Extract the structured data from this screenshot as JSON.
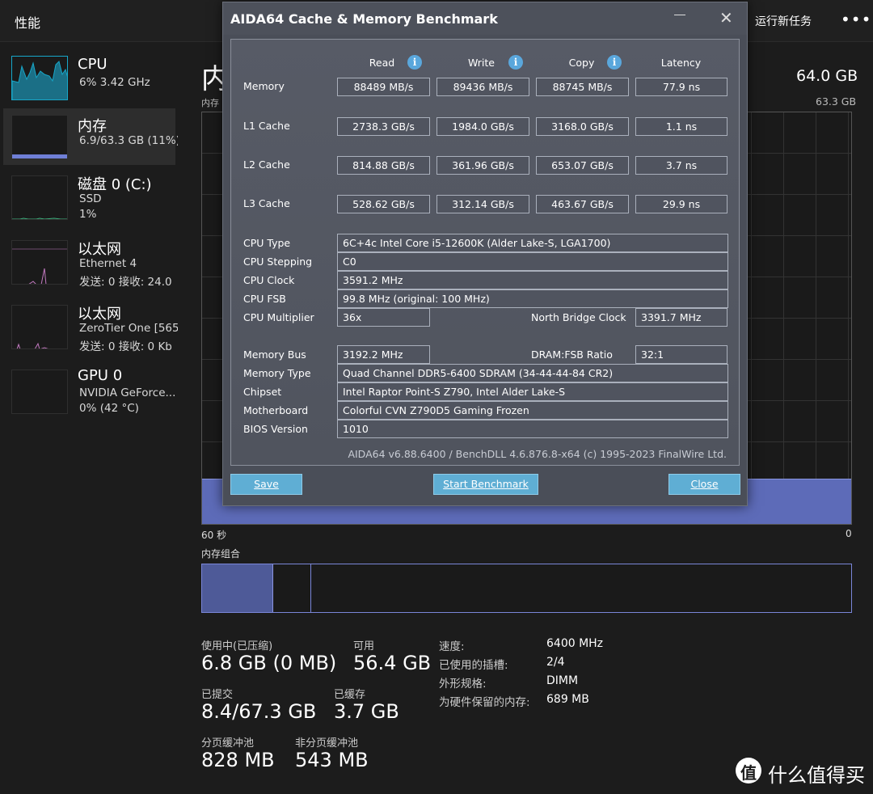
{
  "header": {
    "title": "性能",
    "run_task": "运行新任务",
    "more": "•••"
  },
  "sidebar": {
    "items": [
      {
        "name": "CPU",
        "sub1": "6%  3.42 GHz",
        "sub2": ""
      },
      {
        "name": "内存",
        "sub1": "6.9/63.3 GB (11%)",
        "sub2": ""
      },
      {
        "name": "磁盘 0 (C:)",
        "sub1": "SSD",
        "sub2": "1%"
      },
      {
        "name": "以太网",
        "sub1": "Ethernet 4",
        "sub2": "发送: 0 接收: 24.0"
      },
      {
        "name": "以太网",
        "sub1": "ZeroTier One [565",
        "sub2": "发送: 0 接收: 0 Kb"
      },
      {
        "name": "GPU 0",
        "sub1": "NVIDIA GeForce...",
        "sub2": "0% (42 °C)"
      }
    ],
    "colors": {
      "cpu": "#17a7c9",
      "memory": "#6f7fd6",
      "disk": "#3fb37f",
      "ethernet": "#c37ac1",
      "gpu": "#3c3c3c"
    }
  },
  "main": {
    "title": "内",
    "subtitle_left": "内存",
    "total": "64.0 GB",
    "graph_max": "63.3 GB",
    "graph_usage_fraction": 0.11,
    "axis_left": "60 秒",
    "axis_right": "0",
    "composition_label": "内存组合",
    "composition": {
      "in_use_fraction": 0.11,
      "standby_end_fraction": 0.168
    },
    "stats": {
      "in_use_label": "使用中(已压缩)",
      "in_use_value": "6.8 GB (0 MB)",
      "available_label": "可用",
      "available_value": "56.4 GB",
      "committed_label": "已提交",
      "committed_value": "8.4/67.3 GB",
      "cached_label": "已缓存",
      "cached_value": "3.7 GB",
      "paged_label": "分页缓冲池",
      "paged_value": "828 MB",
      "nonpaged_label": "非分页缓冲池",
      "nonpaged_value": "543 MB"
    },
    "specs": [
      {
        "key": "速度:",
        "value": "6400 MHz"
      },
      {
        "key": "已使用的插槽:",
        "value": "2/4"
      },
      {
        "key": "外形规格:",
        "value": "DIMM"
      },
      {
        "key": "为硬件保留的内存:",
        "value": "689 MB"
      }
    ]
  },
  "dialog": {
    "title": "AIDA64 Cache & Memory Benchmark",
    "columns": [
      "Read",
      "Write",
      "Copy",
      "Latency"
    ],
    "rows": [
      {
        "label": "Memory",
        "values": [
          "88489 MB/s",
          "89436 MB/s",
          "88745 MB/s",
          "77.9 ns"
        ]
      },
      {
        "label": "L1 Cache",
        "values": [
          "2738.3 GB/s",
          "1984.0 GB/s",
          "3168.0 GB/s",
          "1.1 ns"
        ]
      },
      {
        "label": "L2 Cache",
        "values": [
          "814.88 GB/s",
          "361.96 GB/s",
          "653.07 GB/s",
          "3.7 ns"
        ]
      },
      {
        "label": "L3 Cache",
        "values": [
          "528.62 GB/s",
          "312.14 GB/s",
          "463.67 GB/s",
          "29.9 ns"
        ]
      }
    ],
    "cpu": {
      "type_label": "CPU Type",
      "type_value": "6C+4c Intel Core i5-12600K  (Alder Lake-S, LGA1700)",
      "stepping_label": "CPU Stepping",
      "stepping_value": "C0",
      "clock_label": "CPU Clock",
      "clock_value": "3591.2 MHz",
      "fsb_label": "CPU FSB",
      "fsb_value": "99.8 MHz  (original: 100 MHz)",
      "mult_label": "CPU Multiplier",
      "mult_value": "36x",
      "nb_label": "North Bridge Clock",
      "nb_value": "3391.7 MHz"
    },
    "mem": {
      "bus_label": "Memory Bus",
      "bus_value": "3192.2 MHz",
      "ratio_label": "DRAM:FSB Ratio",
      "ratio_value": "32:1",
      "type_label": "Memory Type",
      "type_value": "Quad Channel DDR5-6400 SDRAM  (34-44-44-84 CR2)",
      "chipset_label": "Chipset",
      "chipset_value": "Intel Raptor Point-S Z790, Intel Alder Lake-S",
      "mb_label": "Motherboard",
      "mb_value": "Colorful CVN Z790D5 Gaming Frozen",
      "bios_label": "BIOS Version",
      "bios_value": "1010"
    },
    "footer": "AIDA64 v6.88.6400 / BenchDLL 4.6.876.8-x64  (c) 1995-2023 FinalWire Ltd.",
    "buttons": {
      "save": "Save",
      "start": "Start Benchmark",
      "close": "Close"
    }
  },
  "watermark": {
    "logo": "值",
    "text": "什么值得买"
  }
}
